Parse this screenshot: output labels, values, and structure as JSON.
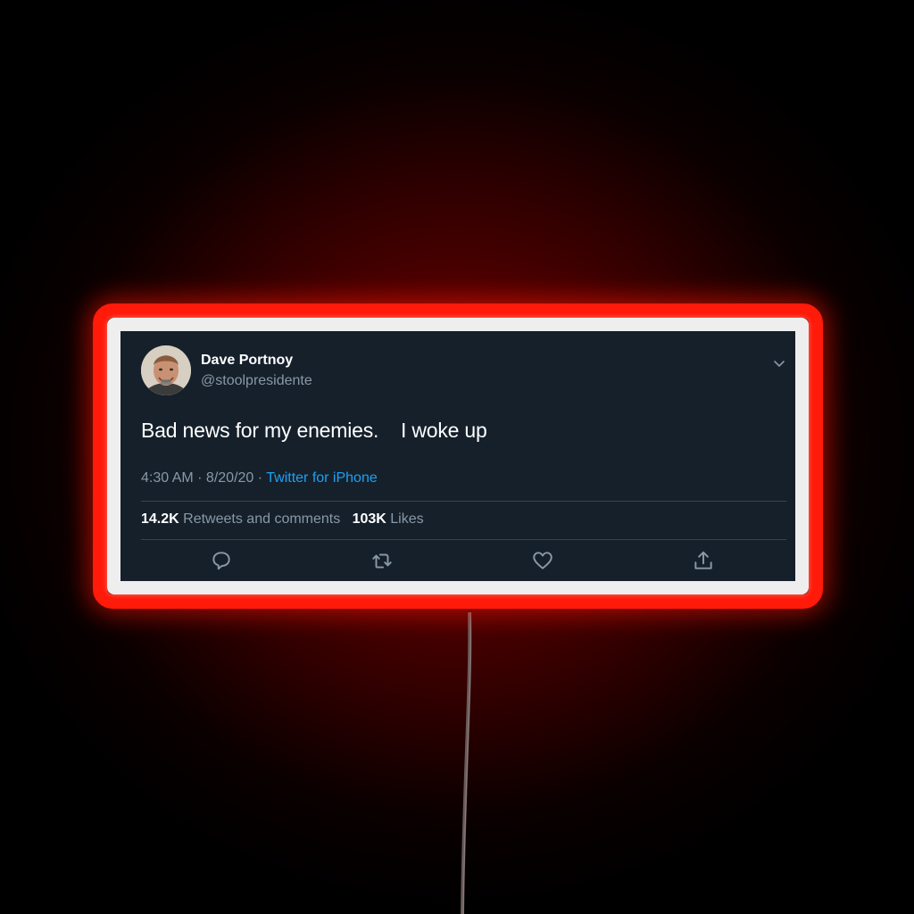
{
  "tweet": {
    "author_name": "Dave Portnoy",
    "author_handle": "@stoolpresidente",
    "text": "Bad news for my enemies.    I woke up",
    "time": "4:30 AM",
    "date": "8/20/20",
    "separator": " · ",
    "source": "Twitter for iPhone",
    "retweets_count": "14.2K",
    "retweets_label": "Retweets and comments",
    "likes_count": "103K",
    "likes_label": "Likes"
  },
  "icons": {
    "menu": "chevron-down-icon",
    "reply": "reply-icon",
    "retweet": "retweet-icon",
    "like": "heart-icon",
    "share": "share-icon"
  },
  "colors": {
    "background": "#15202b",
    "secondary_text": "#8899a6",
    "link": "#1da1f2",
    "neon": "#ff1a0a"
  }
}
